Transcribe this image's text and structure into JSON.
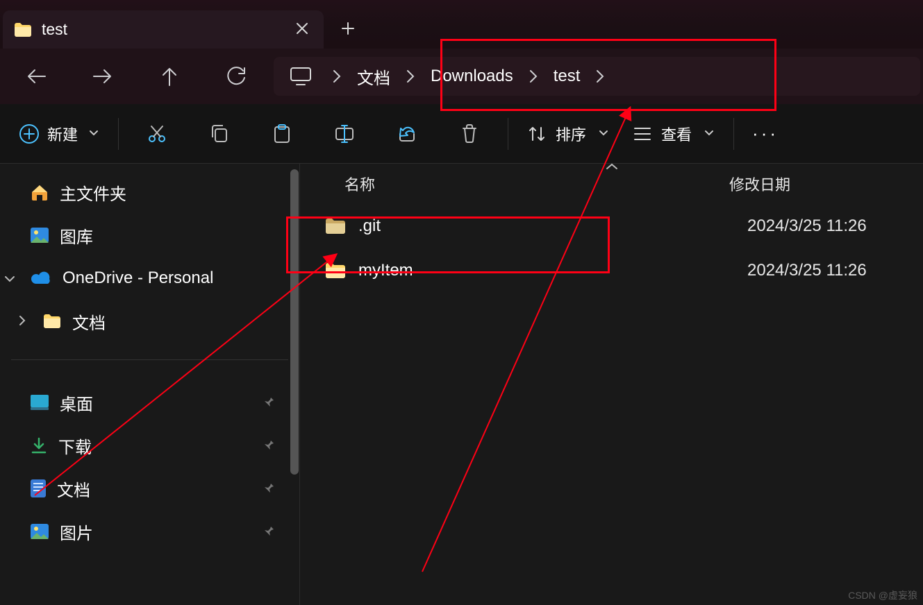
{
  "tab": {
    "title": "test"
  },
  "breadcrumb": {
    "items": [
      "文档",
      "Downloads",
      "test"
    ]
  },
  "toolbar": {
    "new_label": "新建",
    "sort_label": "排序",
    "view_label": "查看"
  },
  "sidebar": {
    "home": "主文件夹",
    "gallery": "图库",
    "onedrive": "OneDrive - Personal",
    "onedrive_child": "文档",
    "quick": {
      "desktop": "桌面",
      "downloads": "下载",
      "documents": "文档",
      "pictures": "图片"
    }
  },
  "columns": {
    "name": "名称",
    "date": "修改日期"
  },
  "rows": [
    {
      "name": ".git",
      "date": "2024/3/25 11:26"
    },
    {
      "name": "myItem",
      "date": "2024/3/25 11:26"
    }
  ],
  "watermark": "CSDN @虚妄狼"
}
